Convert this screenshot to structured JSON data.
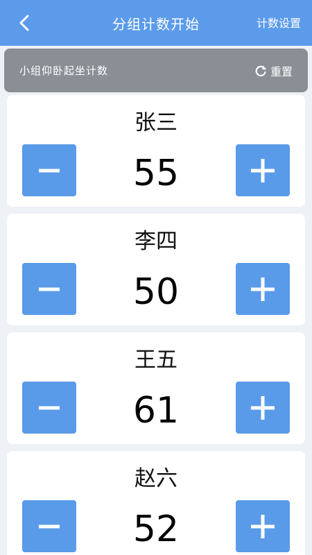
{
  "header": {
    "title": "分组计数开始",
    "settings_label": "计数设置"
  },
  "subheader": {
    "title": "小组仰卧起坐计数",
    "reset_label": "重置"
  },
  "participants": [
    {
      "name": "张三",
      "count": "55"
    },
    {
      "name": "李四",
      "count": "50"
    },
    {
      "name": "王五",
      "count": "61"
    },
    {
      "name": "赵六",
      "count": "52"
    }
  ],
  "colors": {
    "accent": "#5b9bea",
    "subbar": "#8a8f95",
    "background": "#eef1f6"
  },
  "icons": {
    "back": "chevron-left-icon",
    "reset": "refresh-icon",
    "decrement": "minus-icon",
    "increment": "plus-icon"
  }
}
